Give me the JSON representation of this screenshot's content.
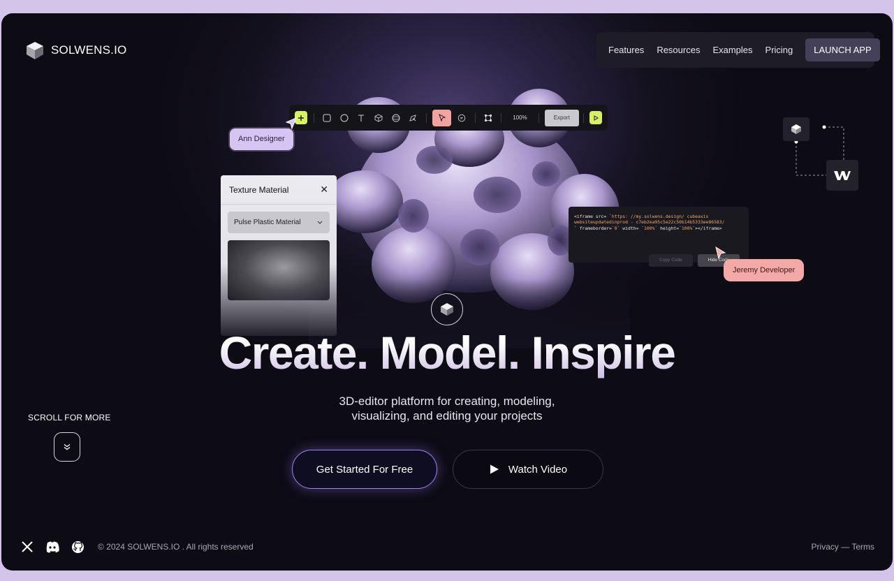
{
  "header": {
    "logo_text": "SOLWENS.IO",
    "nav": [
      "Features",
      "Resources",
      "Examples",
      "Pricing"
    ],
    "launch_label": "LAUNCH APP"
  },
  "toolbar": {
    "zoom": "100%",
    "export_label": "Export"
  },
  "annotations": {
    "designer": "Ann Designer",
    "developer": "Jeremy Developer"
  },
  "texture_panel": {
    "title": "Texture Material",
    "material": "Pulse Plastic Material"
  },
  "code_panel": {
    "line1_tag": "<iframe src= ",
    "line1_str": "`https: //my.solwens.design/ cubeaxis",
    "line2_str": "websiteupdatedinprod - c7eb2ea95c5e22c50b14b5333ee86583/",
    "line3_a": "` frameborder=",
    "line3_b": "`0`",
    "line3_c": " width= ",
    "line3_d": "`100%`",
    "line3_e": " height=",
    "line3_f": "`100%`",
    "line3_g": "></iframe>",
    "copy_label": "Copy Code",
    "hide_label": "Hide Code"
  },
  "hero": {
    "title": "Create. Model. Inspire",
    "subtitle_line1": "3D-editor platform for creating, modeling,",
    "subtitle_line2": "visualizing, and editing your projects",
    "cta_primary": "Get Started For Free",
    "cta_secondary": "Watch Video"
  },
  "scroll": {
    "label": "SCROLL FOR MORE"
  },
  "footer": {
    "copyright": "© 2024 SOLWENS.IO . All rights reserved",
    "privacy": "Privacy",
    "dash": " — ",
    "terms": "Terms"
  },
  "colors": {
    "accent_lime": "#d8f064",
    "accent_pink": "#f4a9a6",
    "accent_lavender": "#d6c4f2",
    "background": "#0d0b14"
  }
}
